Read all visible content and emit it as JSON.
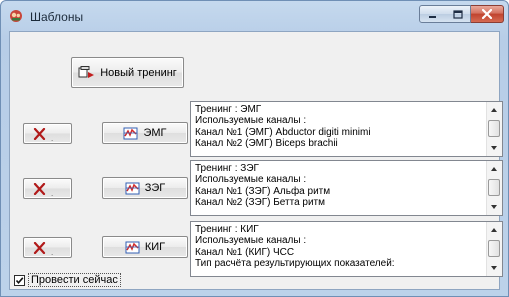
{
  "window": {
    "title": "Шаблоны",
    "controls": {
      "minimize_icon": "minimize-icon",
      "maximize_icon": "maximize-icon",
      "close_icon": "close-icon"
    }
  },
  "new_training_button": {
    "label": "Новый тренинг"
  },
  "trainings": [
    {
      "button_label": "ЭМГ",
      "lines": [
        "Тренинг : ЭМГ",
        "Используемые каналы :",
        "Канал №1 (ЭМГ) Abductor digiti minimi",
        "Канал №2 (ЭМГ) Biceps brachii"
      ]
    },
    {
      "button_label": "ЗЭГ",
      "lines": [
        "Тренинг : ЗЭГ",
        "Используемые каналы :",
        "Канал №1 (ЗЭГ) Альфа ритм",
        "Канал №2 (ЗЭГ) Бетта ритм"
      ]
    },
    {
      "button_label": "КИГ",
      "lines": [
        "Тренинг : КИГ",
        "Используемые каналы :",
        "Канал №1 (КИГ) ЧСС",
        "Тип расчёта результирующих показателей:"
      ]
    }
  ],
  "run_now_checkbox": {
    "label": "Провести сейчас",
    "checked": true
  },
  "colors": {
    "delete_x": "#b11a1a",
    "icon_red": "#d42a2a",
    "icon_blue": "#3460b4"
  }
}
